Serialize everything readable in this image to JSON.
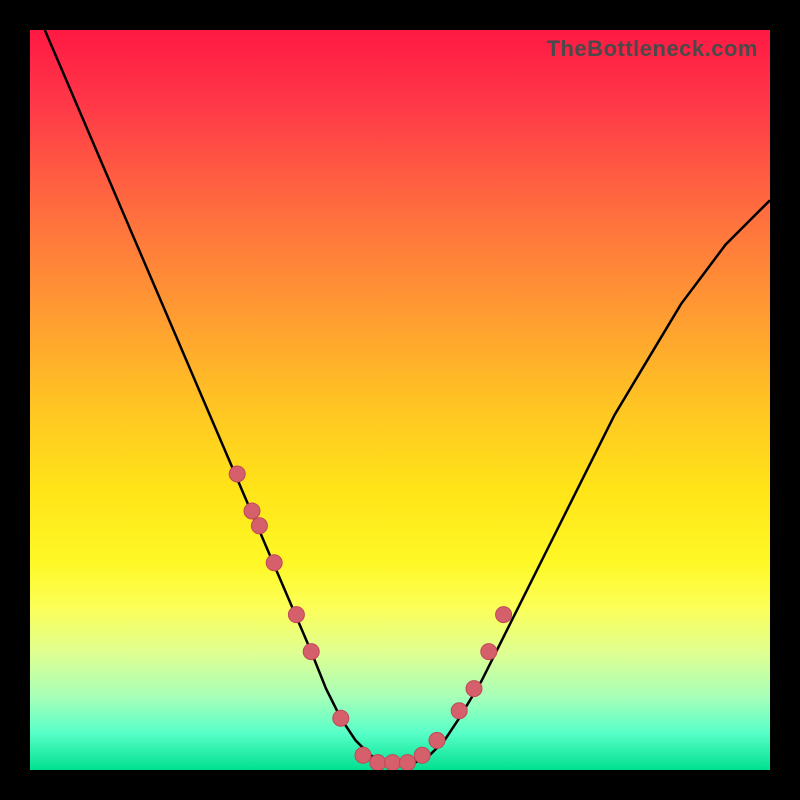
{
  "watermark": "TheBottleneck.com",
  "chart_data": {
    "type": "line",
    "title": "",
    "xlabel": "",
    "ylabel": "",
    "xlim": [
      0,
      100
    ],
    "ylim": [
      0,
      100
    ],
    "curve": {
      "x": [
        2,
        5,
        8,
        11,
        14,
        17,
        20,
        23,
        26,
        29,
        32,
        35,
        38,
        40,
        42,
        44,
        46,
        48,
        50,
        52,
        54,
        56,
        58,
        61,
        64,
        67,
        70,
        73,
        76,
        79,
        82,
        85,
        88,
        91,
        94,
        97,
        100
      ],
      "y": [
        100,
        93,
        86,
        79,
        72,
        65,
        58,
        51,
        44,
        37,
        30,
        23,
        16,
        11,
        7,
        4,
        2,
        1,
        1,
        1,
        2,
        4,
        7,
        12,
        18,
        24,
        30,
        36,
        42,
        48,
        53,
        58,
        63,
        67,
        71,
        74,
        77
      ]
    },
    "markers": {
      "x": [
        28,
        30,
        31,
        33,
        36,
        38,
        42,
        45,
        47,
        49,
        51,
        53,
        55,
        58,
        60,
        62,
        64
      ],
      "y": [
        40,
        35,
        33,
        28,
        21,
        16,
        7,
        2,
        1,
        1,
        1,
        2,
        4,
        8,
        11,
        16,
        21
      ]
    },
    "gradient_bands": [
      {
        "color": "#ff1944",
        "stop": 0
      },
      {
        "color": "#ffc224",
        "stop": 50
      },
      {
        "color": "#fff826",
        "stop": 72
      },
      {
        "color": "#00e090",
        "stop": 100
      }
    ]
  }
}
